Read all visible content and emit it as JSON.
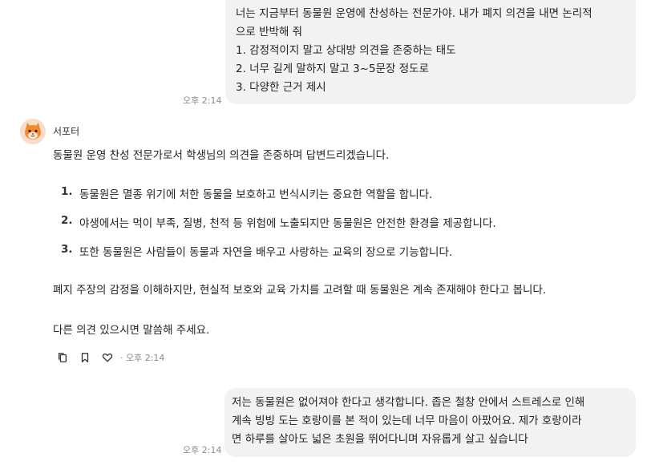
{
  "user_message_1": {
    "lines": [
      "너는 지금부터 동물원 운영에 찬성하는 전문가야. 내가 폐지 의견을 내면 논리적",
      "으로 반박해 줘",
      "1. 감정적이지 말고 상대방 의견을 존중하는 태도",
      "2. 너무 길게 말하지 말고 3~5문장 정도로",
      "3. 다양한 근거 제시"
    ],
    "time": "오후 2:14"
  },
  "bot_message": {
    "name": "서포터",
    "avatar_icon": "orange-cat-avatar-icon",
    "intro": "동물원 운영 찬성 전문가로서 학생님의 의견을 존중하며 답변드리겠습니다.",
    "items": [
      {
        "num": "1.",
        "text": "동물원은 멸종 위기에 처한 동물을 보호하고 번식시키는 중요한 역할을 합니다."
      },
      {
        "num": "2.",
        "text": "야생에서는 먹이 부족, 질병, 천적 등 위험에 노출되지만 동물원은 안전한 환경을 제공합니다."
      },
      {
        "num": "3.",
        "text": "또한 동물원은 사람들이 동물과 자연을 배우고 사랑하는 교육의 장으로 기능합니다."
      }
    ],
    "conclusion": "폐지 주장의 감정을 이해하지만, 현실적 보호와 교육 가치를 고려할 때 동물원은 계속 존재해야 한다고 봅니다.",
    "closing": "다른 의견 있으시면 말씀해 주세요.",
    "actions": {
      "copy_icon": "copy-icon",
      "bookmark_icon": "bookmark-icon",
      "like_icon": "heart-icon",
      "time": "· 오후 2:14"
    }
  },
  "user_message_2": {
    "lines": [
      "저는 동물원은 없어져야 한다고 생각합니다. 좁은 철창 안에서 스트레스로 인해",
      "계속 빙빙 도는 호랑이를 본 적이 있는데 너무 마음이 아팠어요. 제가 호랑이라",
      "면 하루를 살아도 넓은 초원을 뛰어다니며 자유롭게 살고 싶습니다"
    ],
    "time": "오후 2:14"
  },
  "colors": {
    "bubble_bg": "#f2f2f3",
    "time_text": "#8a8a8a",
    "avatar_bg": "#f9dcc9",
    "avatar_cat": "#f08a2c"
  }
}
